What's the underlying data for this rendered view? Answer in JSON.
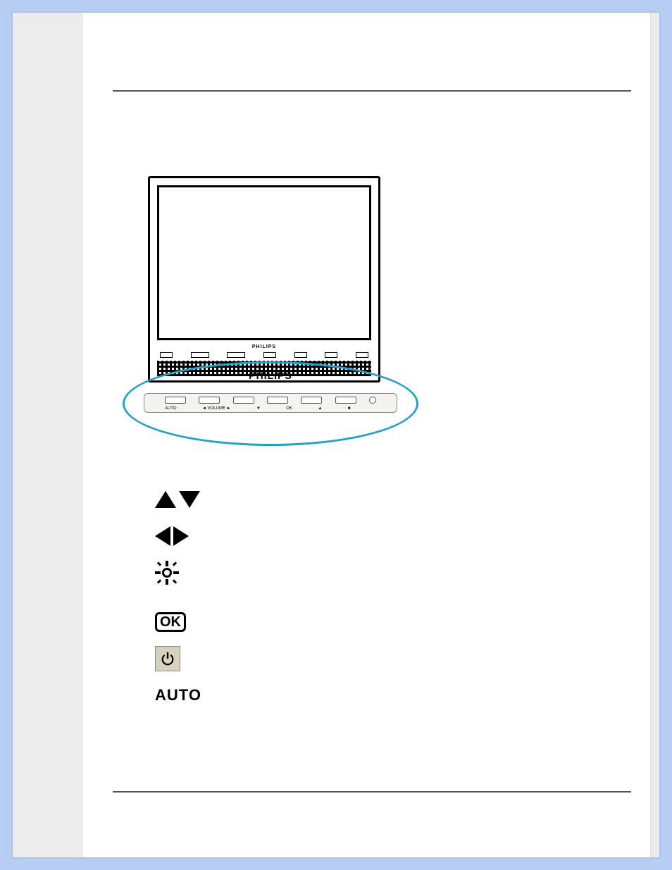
{
  "brand": "PHILIPS",
  "base_button_labels": [
    "AUTO",
    "◄ VOLUME ►",
    "▼",
    "OK",
    "▲",
    "■",
    ""
  ],
  "legend": {
    "up_down_icon": "up-down-icon",
    "left_right_icon": "left-right-icon",
    "brightness_icon": "brightness-icon",
    "ok_label": "OK",
    "power_icon": "power-icon",
    "auto_label": "AUTO"
  }
}
